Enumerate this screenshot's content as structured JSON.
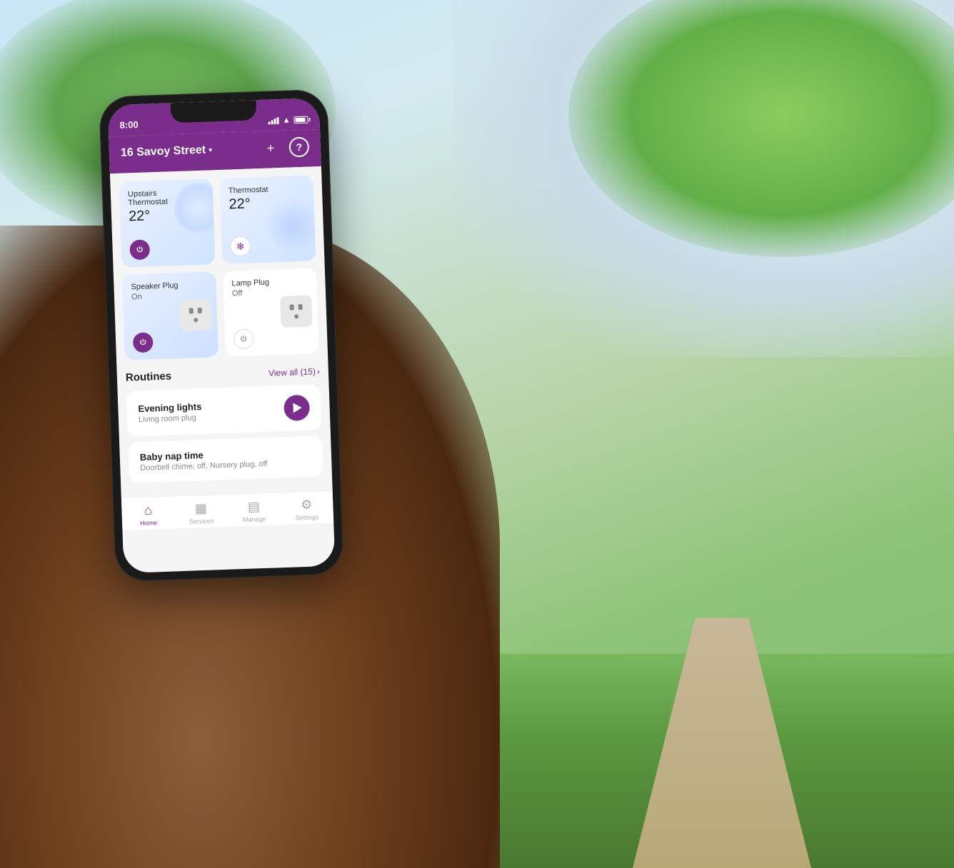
{
  "background": {
    "description": "outdoor park scene with trees and path"
  },
  "phone": {
    "status_bar": {
      "time": "8:00",
      "signal": "full",
      "wifi": "on",
      "battery": "full"
    },
    "header": {
      "title": "16 Savoy Street",
      "dropdown_arrow": "▾",
      "add_button": "+",
      "help_button": "?"
    },
    "devices": [
      {
        "name": "Upstairs Thermostat",
        "temp": "22°",
        "type": "thermostat",
        "state": "active"
      },
      {
        "name": "Thermostat",
        "temp": "22°",
        "type": "thermostat",
        "state": "cooling"
      },
      {
        "name": "Speaker Plug",
        "status": "On",
        "type": "plug",
        "state": "on"
      },
      {
        "name": "Lamp Plug",
        "status": "Off",
        "type": "plug",
        "state": "off"
      }
    ],
    "routines": {
      "section_title": "Routines",
      "view_all_label": "View all (15)",
      "items": [
        {
          "name": "Evening lights",
          "description": "Living room plug",
          "has_play": true
        },
        {
          "name": "Baby nap time",
          "description": "Doorbell chime, off, Nursery plug, off",
          "has_play": false
        }
      ]
    },
    "nav": {
      "items": [
        {
          "label": "Home",
          "icon": "🏠",
          "active": true
        },
        {
          "label": "Services",
          "icon": "📊",
          "active": false
        },
        {
          "label": "Manage",
          "icon": "📋",
          "active": false
        },
        {
          "label": "Settings",
          "icon": "⚙️",
          "active": false
        }
      ]
    }
  }
}
